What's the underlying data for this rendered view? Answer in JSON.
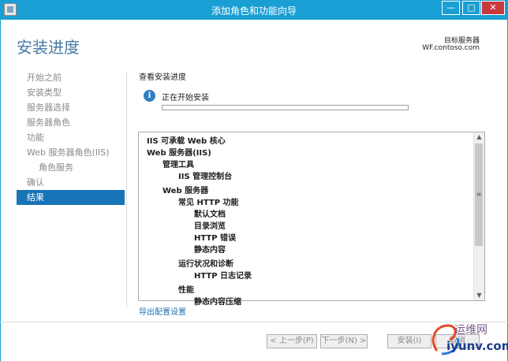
{
  "window": {
    "title": "添加角色和功能向导",
    "minimize_glyph": "—",
    "maximize_glyph": "□",
    "close_glyph": "✕"
  },
  "header": {
    "page_title": "安装进度",
    "destination_label": "目标服务器",
    "destination_server": "WF.contoso.com"
  },
  "nav": {
    "items": [
      {
        "label": "开始之前",
        "active": false,
        "sub": false
      },
      {
        "label": "安装类型",
        "active": false,
        "sub": false
      },
      {
        "label": "服务器选择",
        "active": false,
        "sub": false
      },
      {
        "label": "服务器角色",
        "active": false,
        "sub": false
      },
      {
        "label": "功能",
        "active": false,
        "sub": false
      },
      {
        "label": "Web 服务器角色(IIS)",
        "active": false,
        "sub": false
      },
      {
        "label": "角色服务",
        "active": false,
        "sub": true
      },
      {
        "label": "确认",
        "active": false,
        "sub": false
      },
      {
        "label": "结果",
        "active": true,
        "sub": false
      }
    ]
  },
  "main": {
    "section_label": "查看安装进度",
    "status_text": "正在开始安装",
    "progress_fraction": 0.0,
    "results": [
      {
        "text": "IIS 可承载 Web 核心",
        "level": 0,
        "gap": false
      },
      {
        "text": "Web 服务器(IIS)",
        "level": 0,
        "gap": false
      },
      {
        "text": "管理工具",
        "level": 1,
        "gap": false
      },
      {
        "text": "IIS 管理控制台",
        "level": 2,
        "gap": false
      },
      {
        "text": "Web 服务器",
        "level": 1,
        "gap": true
      },
      {
        "text": "常见 HTTP 功能",
        "level": 2,
        "gap": false
      },
      {
        "text": "默认文档",
        "level": 3,
        "gap": false
      },
      {
        "text": "目录浏览",
        "level": 3,
        "gap": false
      },
      {
        "text": "HTTP 错误",
        "level": 3,
        "gap": false
      },
      {
        "text": "静态内容",
        "level": 3,
        "gap": false
      },
      {
        "text": "运行状况和诊断",
        "level": 2,
        "gap": true
      },
      {
        "text": "HTTP 日志记录",
        "level": 3,
        "gap": false
      },
      {
        "text": "性能",
        "level": 2,
        "gap": true
      },
      {
        "text": "静态内容压缩",
        "level": 3,
        "gap": false
      }
    ],
    "export_link": "导出配置设置"
  },
  "footer": {
    "prev_label": "< 上一步(P)",
    "next_label": "下一步(N) >",
    "install_label": "安装(I)",
    "cancel_label": "取消"
  },
  "watermark": {
    "line1": "运维网",
    "line2": "iyunv.com"
  },
  "colors": {
    "titlebar": "#1a9fd4",
    "accent": "#1774b7",
    "title_blue": "#4a7aa5",
    "link": "#1c6fb4"
  }
}
